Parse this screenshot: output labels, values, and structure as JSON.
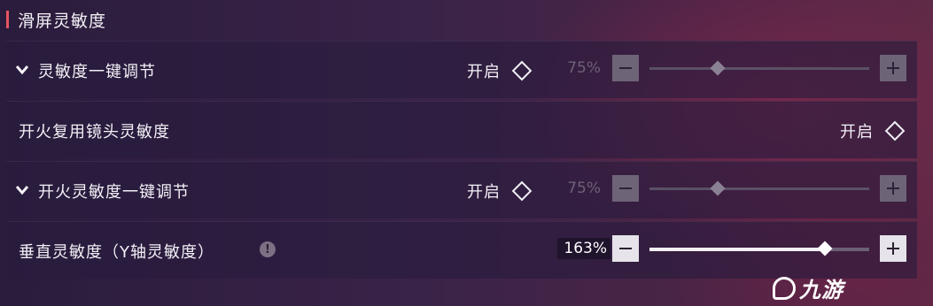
{
  "section": {
    "title": "滑屏灵敏度"
  },
  "rows": [
    {
      "label": "灵敏度一键调节",
      "toggle_label": "开启",
      "value_text": "75%",
      "slider_fraction": 0.31,
      "minus": "−",
      "plus": "+"
    },
    {
      "label": "开火复用镜头灵敏度",
      "toggle_label": "开启"
    },
    {
      "label": "开火灵敏度一键调节",
      "toggle_label": "开启",
      "value_text": "75%",
      "slider_fraction": 0.31,
      "minus": "−",
      "plus": "+"
    },
    {
      "label": "垂直灵敏度（Y轴灵敏度）",
      "value_text": "163%",
      "slider_fraction": 0.8,
      "minus": "−",
      "plus": "+"
    }
  ],
  "icons": {
    "chevron": "chevron-down-icon",
    "toggle": "diamond-toggle-icon",
    "info": "info-icon",
    "info_glyph": "!"
  },
  "watermark": {
    "text": "九游"
  },
  "colors": {
    "accent": "#e4565e",
    "row_bg": "#2a1c3e"
  }
}
